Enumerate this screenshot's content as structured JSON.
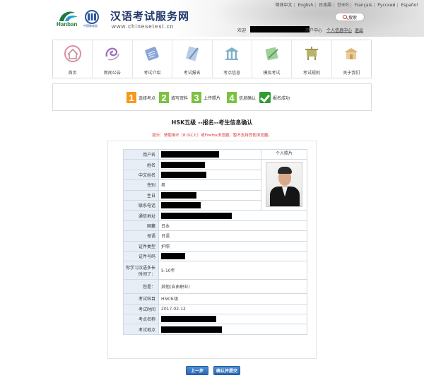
{
  "header": {
    "logo_text": "Hanban",
    "logo2_sub": "中国教育部",
    "site_title": "汉语考试服务网",
    "site_url": "www.chinesetest.cn",
    "languages": [
      "简体中文",
      "English",
      "日本語",
      "한국어",
      "Français",
      "Русский",
      "Español"
    ],
    "search_label": "搜索",
    "welcome": "欢迎",
    "user_center": "用户中心",
    "personal_info": "个人信息中心",
    "logout": "退出"
  },
  "nav": {
    "items": [
      {
        "label": "首页",
        "icon": "home-icon"
      },
      {
        "label": "新闻公告",
        "icon": "news-icon"
      },
      {
        "label": "考试介绍",
        "icon": "intro-icon"
      },
      {
        "label": "考试报名",
        "icon": "registration-icon"
      },
      {
        "label": "考点信息",
        "icon": "test-center-icon"
      },
      {
        "label": "模拟考试",
        "icon": "mock-test-icon"
      },
      {
        "label": "考试规则",
        "icon": "rules-icon"
      },
      {
        "label": "关于我们",
        "icon": "about-icon"
      }
    ]
  },
  "steps": [
    {
      "num": "1",
      "label": "选择考点"
    },
    {
      "num": "2",
      "label": "填写资料"
    },
    {
      "num": "3",
      "label": "上传照片"
    },
    {
      "num": "4",
      "label": "信息确认"
    },
    {
      "num": "",
      "label": "报名成功"
    }
  ],
  "page": {
    "title": "HSK五级 --报名--考生信息确认",
    "notice": "提示：请使用IE（8.0以上）或Firefox浏览器，暂不支持其他浏览器。"
  },
  "form": {
    "photo_header": "个人照片",
    "rows": [
      {
        "key": "用户名",
        "value": "",
        "redacted": true
      },
      {
        "key": "姓名",
        "value": "",
        "redacted": true
      },
      {
        "key": "中文姓名",
        "value": "",
        "redacted": true
      },
      {
        "key": "性别",
        "value": "男"
      },
      {
        "key": "生日",
        "value": "",
        "redacted": true
      },
      {
        "key": "联系电话",
        "value": "",
        "redacted": true
      },
      {
        "key": "通信地址",
        "value": "",
        "redacted": true
      },
      {
        "key": "国籍",
        "value": "日本"
      },
      {
        "key": "母语",
        "value": "日语"
      },
      {
        "key": "证件类型",
        "value": "护照"
      },
      {
        "key": "证件号码",
        "value": "",
        "redacted": true
      },
      {
        "key": "你学习汉语多长时间了：",
        "value": "5-10年"
      },
      {
        "key": "您是：",
        "value": "其他(自由职业)"
      },
      {
        "key": "考试科目",
        "value": "HSK五级"
      },
      {
        "key": "考试时间",
        "value": "2017-02-12"
      },
      {
        "key": "考点名称",
        "value": "",
        "redacted": true
      },
      {
        "key": "考试地点",
        "value": "",
        "redacted": true
      }
    ]
  },
  "buttons": {
    "prev": "上一步",
    "submit": "确认并提交"
  }
}
